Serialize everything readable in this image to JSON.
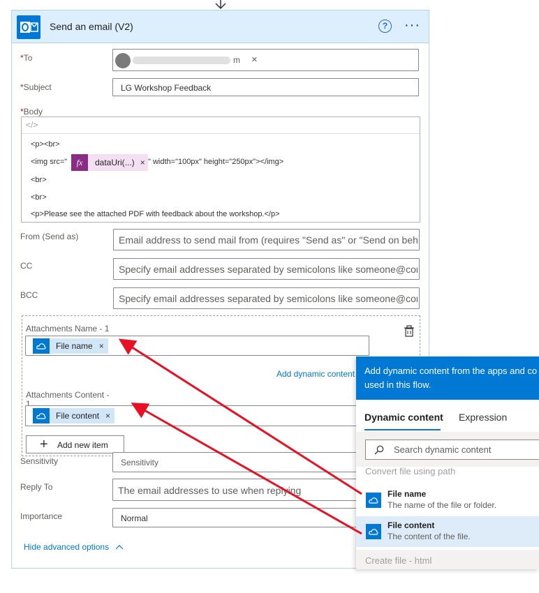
{
  "card": {
    "title": "Send an email (V2)",
    "help_glyph": "?",
    "more_glyph": "···"
  },
  "to": {
    "label": "To",
    "required_mark": "*",
    "recipient_visible_suffix": "m",
    "close_glyph": "×"
  },
  "subject": {
    "label": "Subject",
    "required_mark": "*",
    "value": "LG Workshop Feedback"
  },
  "body": {
    "label": "Body",
    "required_mark": "*",
    "code_toggle": "</>",
    "line1": "<p><br>",
    "line2_prefix": "<img src=\"",
    "fx_glyph": "fx",
    "fx_token": "dataUri(...)",
    "line2_suffix": "\" width=\"100px\" height=\"250px\"></img>",
    "line3": "<br>",
    "line4": "<br>",
    "line5": "<p>Please see the attached PDF with feedback about the workshop.</p>"
  },
  "from": {
    "label": "From (Send as)",
    "placeholder": "Email address to send mail from (requires \"Send as\" or \"Send on beh"
  },
  "cc": {
    "label": "CC",
    "placeholder": "Specify email addresses separated by semicolons like someone@con"
  },
  "bcc": {
    "label": "BCC",
    "placeholder": "Specify email addresses separated by semicolons like someone@con"
  },
  "attachments": {
    "name_label": "Attachments Name - 1",
    "name_token": "File name",
    "add_dynamic": "Add dynamic content",
    "content_label": "Attachments Content -",
    "content_label_2": "1",
    "content_token": "File content",
    "add_item": "Add new item",
    "plus_glyph": "+"
  },
  "sensitivity": {
    "label": "Sensitivity",
    "value": "Sensitivity"
  },
  "reply_to": {
    "label": "Reply To",
    "placeholder": "The email addresses to use when replying"
  },
  "importance": {
    "label": "Importance",
    "value": "Normal"
  },
  "hide_advanced": "Hide advanced options",
  "dynamic_panel": {
    "header_line1": "Add dynamic content from the apps and co",
    "header_line2": "used in this flow.",
    "tab_dynamic": "Dynamic content",
    "tab_expression": "Expression",
    "search_placeholder": "Search dynamic content",
    "section_convert": "Convert file using path",
    "items": [
      {
        "name": "File name",
        "desc": "The name of the file or folder."
      },
      {
        "name": "File content",
        "desc": "The content of the file."
      }
    ],
    "section_create": "Create file - html"
  },
  "colors": {
    "accent": "#0078d4",
    "arrow": "#e81123",
    "fx_token": "#8b2c86",
    "header_bg": "#ddeefc"
  }
}
